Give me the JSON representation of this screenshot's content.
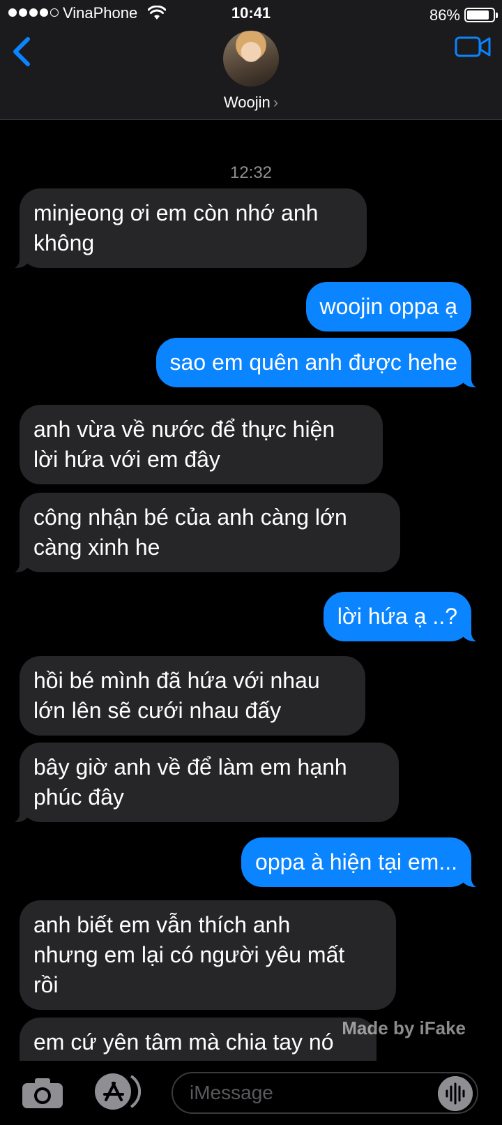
{
  "status": {
    "carrier": "VinaPhone",
    "time": "10:41",
    "battery": "86%",
    "battery_level": 0.86
  },
  "header": {
    "contact_name": "Woojin",
    "chevron": "›"
  },
  "timestamp": "12:32",
  "messages": [
    {
      "from": "them",
      "text": "minjeong ơi em còn nhớ anh\nkhông"
    },
    {
      "from": "me",
      "text": "woojin oppa ạ"
    },
    {
      "from": "me",
      "text": "sao em quên anh được hehe"
    },
    {
      "from": "them",
      "text": "anh vừa về nước để thực hiện\nlời hứa với em đây"
    },
    {
      "from": "them",
      "text": "công nhận bé của anh càng lớn\ncàng xinh he"
    },
    {
      "from": "me",
      "text": "lời hứa ạ ..?"
    },
    {
      "from": "them",
      "text": "hồi bé mình đã hứa với nhau\nlớn lên sẽ cưới nhau đấy"
    },
    {
      "from": "them",
      "text": "bây giờ anh về để làm em hạnh\nphúc đây"
    },
    {
      "from": "me",
      "text": "oppa à hiện tại em..."
    },
    {
      "from": "them",
      "text": "anh biết em vẫn thích anh\nnhưng em lại có người yêu mất\nrồi"
    },
    {
      "from": "them",
      "text": "em cứ yên tâm mà chia tay nó"
    }
  ],
  "watermark": "Made by iFake",
  "composer": {
    "placeholder": "iMessage"
  },
  "icons": {
    "back": "chevron-left-icon",
    "video": "video-camera-icon",
    "camera": "camera-icon",
    "appstore": "app-store-icon",
    "audio": "waveform-icon",
    "wifi": "wifi-icon"
  },
  "colors": {
    "accent": "#0a84ff",
    "incoming_bubble": "#262628",
    "header_bg": "#1b1b1d",
    "background": "#000000"
  }
}
